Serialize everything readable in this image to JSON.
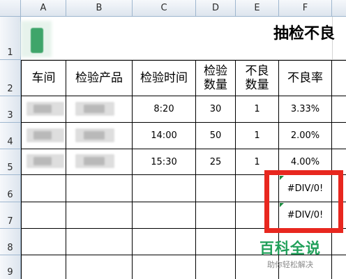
{
  "columns": [
    "A",
    "B",
    "C",
    "D",
    "E",
    "F"
  ],
  "rows": [
    "1",
    "2",
    "3",
    "4",
    "5",
    "6",
    "7",
    "8",
    "9"
  ],
  "title": "抽检不良",
  "headers": {
    "workshop": "车间",
    "product": "检验产品",
    "time": "检验时间",
    "quantity": "检验\n数量",
    "defects": "不良\n数量",
    "rate": "不良率"
  },
  "data_rows": [
    {
      "time": "8:20",
      "quantity": "30",
      "defects": "1",
      "rate": "3.33%"
    },
    {
      "time": "14:00",
      "quantity": "50",
      "defects": "1",
      "rate": "2.00%"
    },
    {
      "time": "15:30",
      "quantity": "25",
      "defects": "1",
      "rate": "4.00%"
    }
  ],
  "errors": [
    "#DIV/0!",
    "#DIV/0!"
  ],
  "watermark": {
    "main": "百科全说",
    "sub": "助你轻松解决"
  },
  "colors": {
    "highlight": "#e8271f",
    "watermark": "#21a05a",
    "error_flag": "#1a8a3e"
  }
}
